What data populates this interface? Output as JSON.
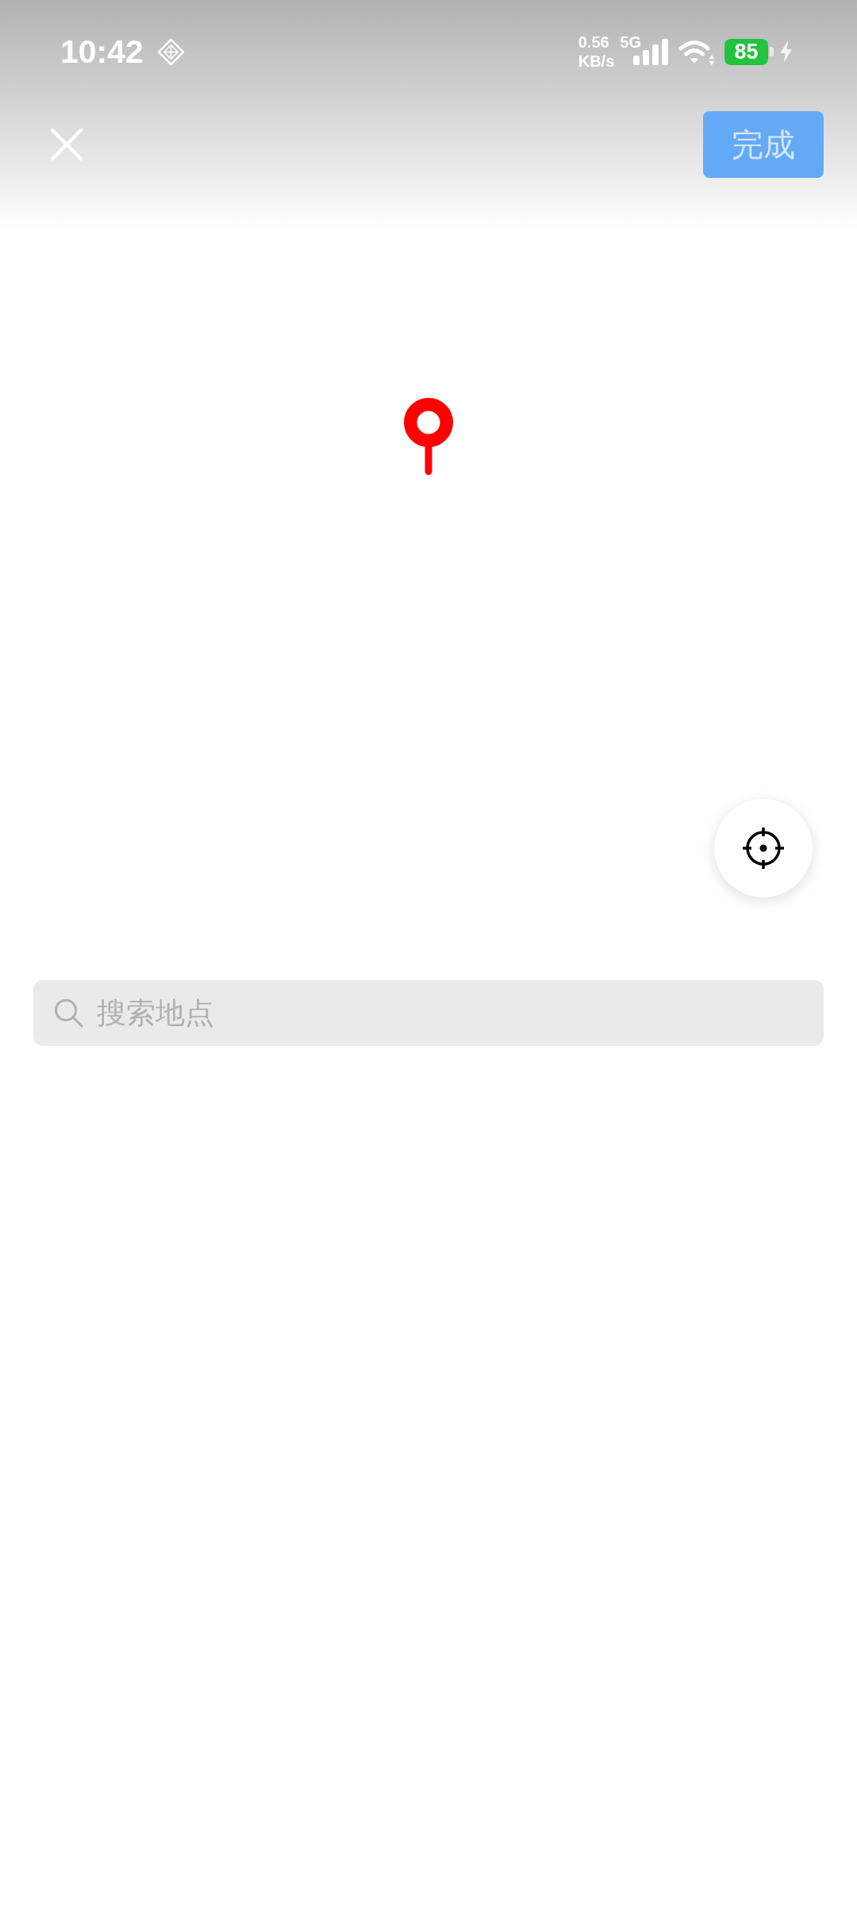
{
  "status_bar": {
    "time": "10:42",
    "net_speed_value": "0.56",
    "net_speed_unit": "KB/s",
    "network": "5G",
    "battery": "85",
    "charging": true
  },
  "header": {
    "done_button": {
      "label": "完成",
      "disabled": true
    }
  },
  "search": {
    "placeholder": "搜索地点"
  }
}
